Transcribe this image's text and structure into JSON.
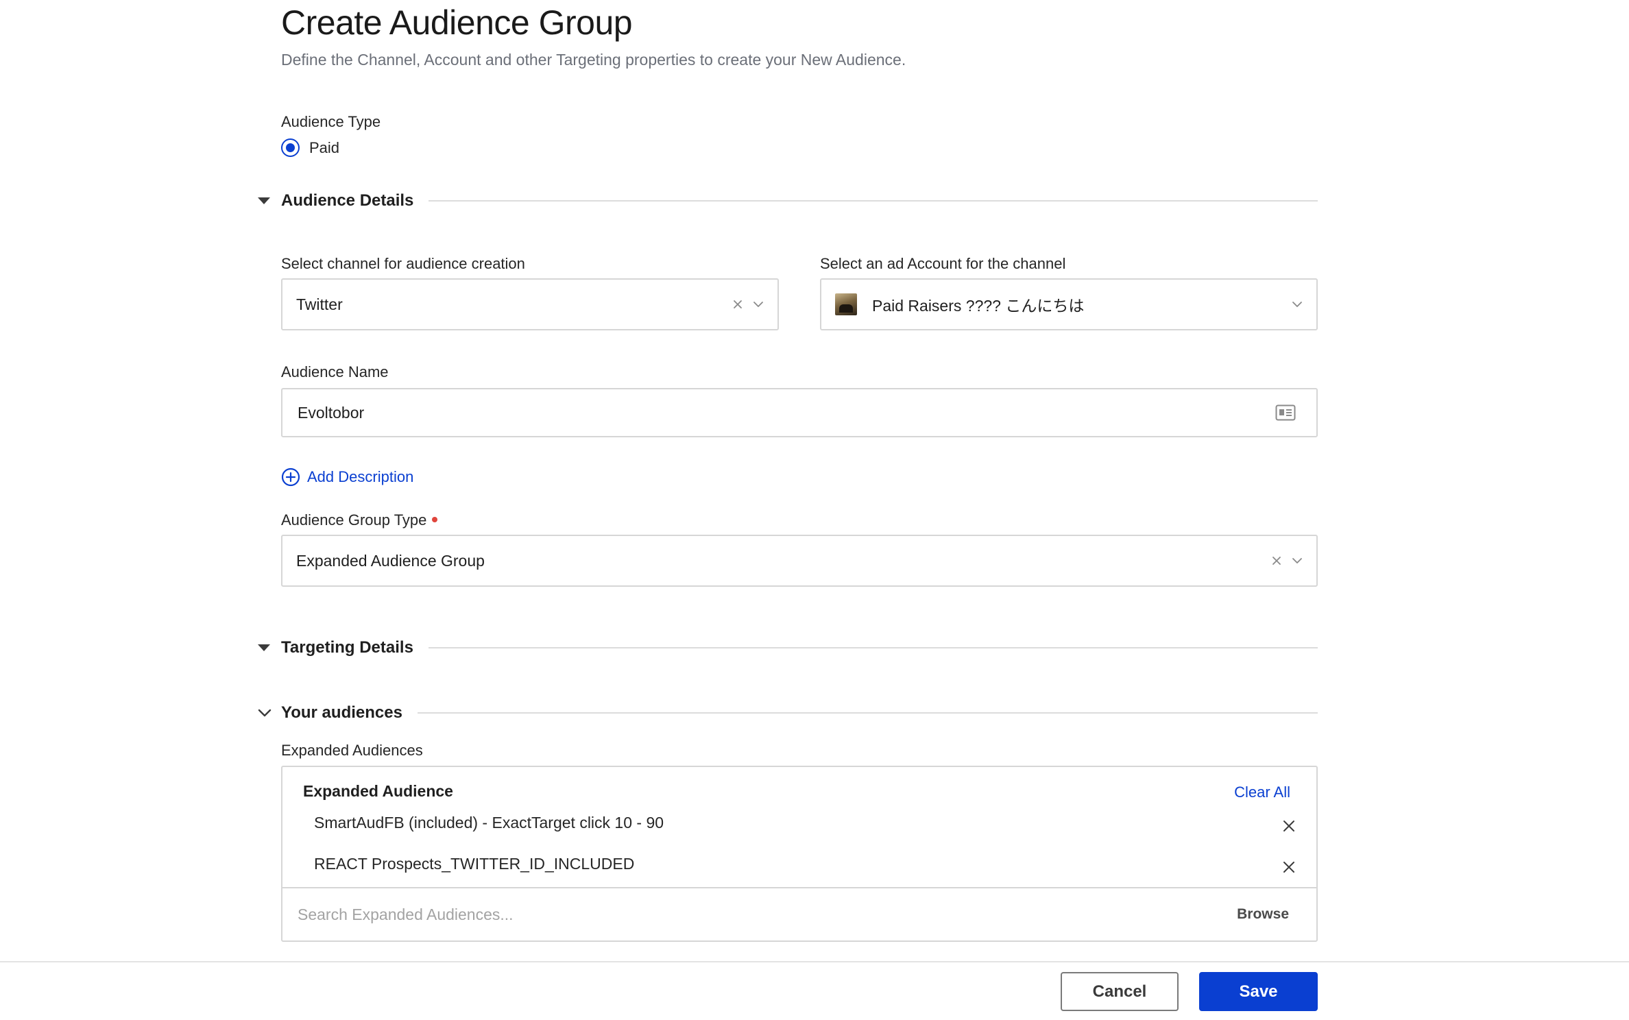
{
  "header": {
    "title": "Create Audience Group",
    "subtitle": "Define the Channel, Account and other Targeting properties to create your New Audience."
  },
  "audience_type": {
    "label": "Audience Type",
    "options": [
      {
        "label": "Paid",
        "selected": true
      }
    ]
  },
  "sections": {
    "audience_details": "Audience Details",
    "targeting_details": "Targeting Details",
    "your_audiences": "Your audiences"
  },
  "channel": {
    "label": "Select channel for audience creation",
    "value": "Twitter"
  },
  "ad_account": {
    "label": "Select an ad Account for the channel",
    "value": "Paid Raisers ???? こんにちは"
  },
  "audience_name": {
    "label": "Audience Name",
    "value": "Evoltobor"
  },
  "add_description": "Add Description",
  "group_type": {
    "label": "Audience Group Type",
    "required": true,
    "value": "Expanded Audience Group"
  },
  "expanded_audiences": {
    "label": "Expanded Audiences",
    "heading": "Expanded Audience",
    "clear_all": "Clear All",
    "items": [
      "SmartAudFB (included) - ExactTarget click 10 - 90",
      "REACT Prospects_TWITTER_ID_INCLUDED"
    ],
    "search_placeholder": "Search Expanded Audiences...",
    "browse": "Browse"
  },
  "footer": {
    "cancel": "Cancel",
    "save": "Save"
  },
  "colors": {
    "accent": "#0a3fd1",
    "required": "#e0453c",
    "border": "#d6d6d6"
  }
}
